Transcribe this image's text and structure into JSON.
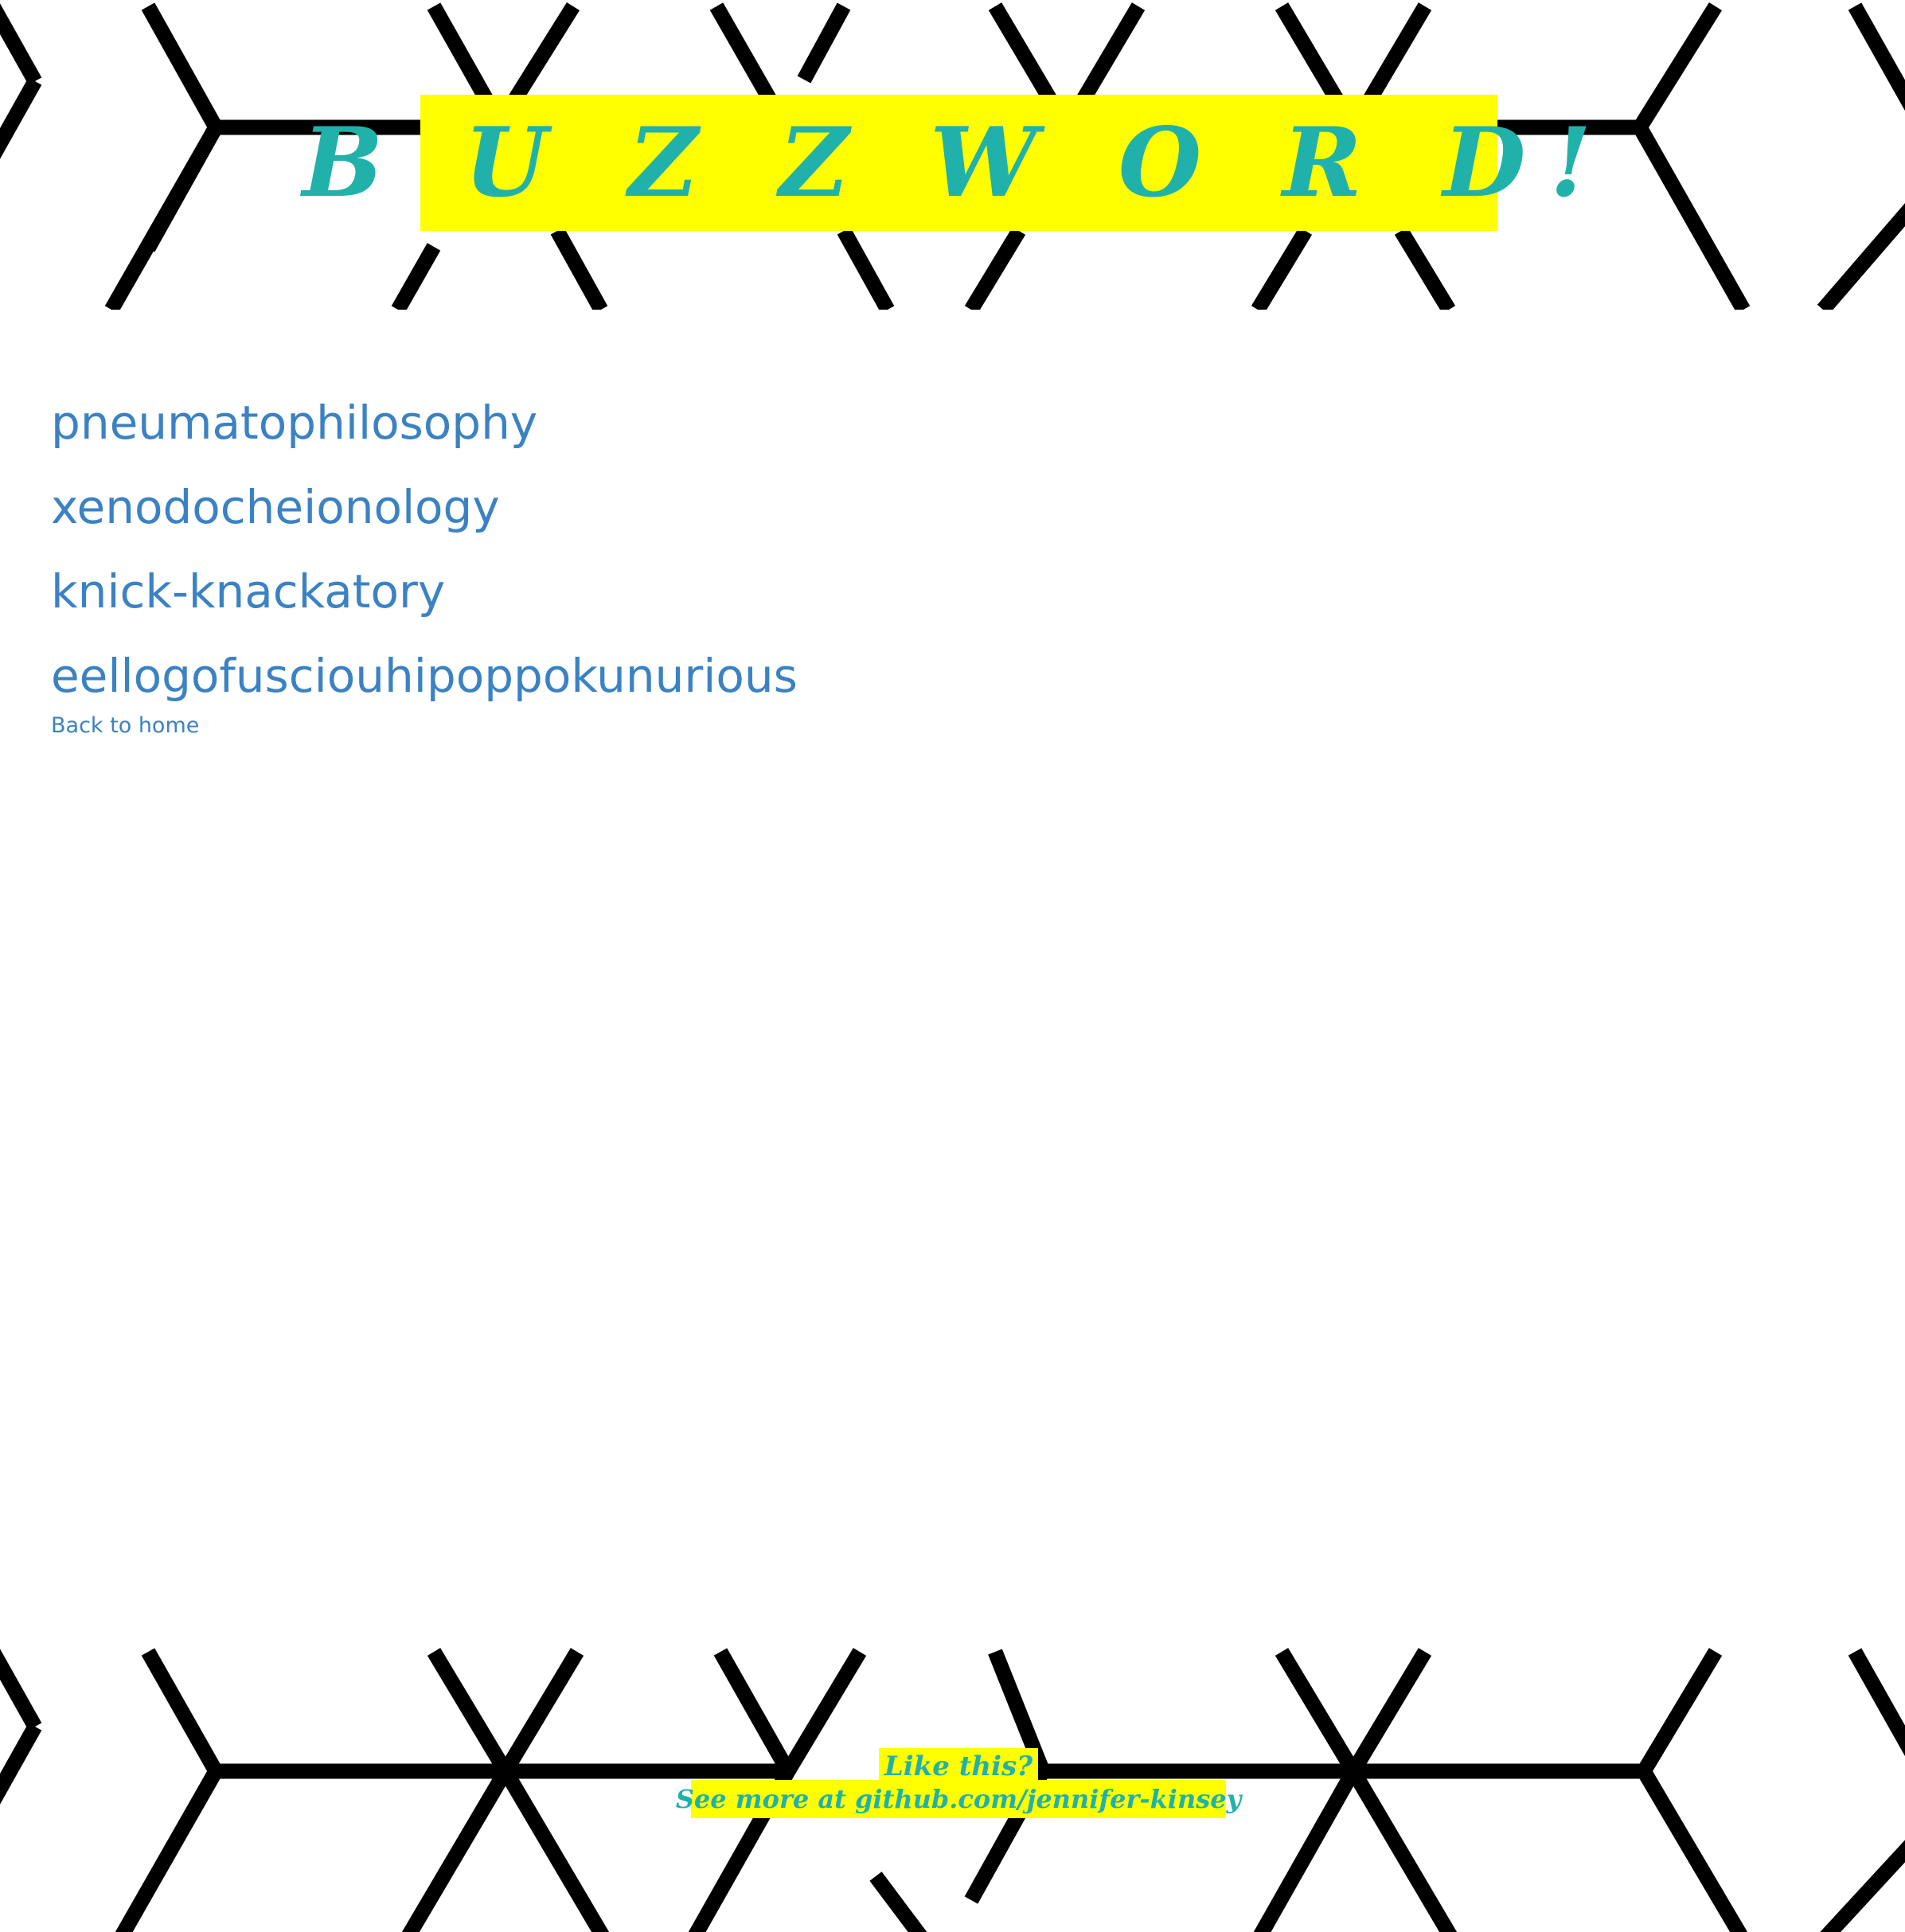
{
  "header": {
    "title": "B U Z Z W O R D!"
  },
  "words": [
    "pneumatophilosophy",
    "xenodocheionology",
    "knick-knackatory",
    "eellogofusciouhipoppokunurious"
  ],
  "nav": {
    "back_label": "Back to home"
  },
  "footer": {
    "line1": "Like this?",
    "line2": "See more at github.com/jennifer-kinsey"
  },
  "colors": {
    "accent_yellow": "#ffff00",
    "title_teal": "#20b2aa",
    "link_blue": "#3b82c4",
    "pattern_black": "#000000"
  },
  "icons": {
    "background": "hex-pattern"
  }
}
